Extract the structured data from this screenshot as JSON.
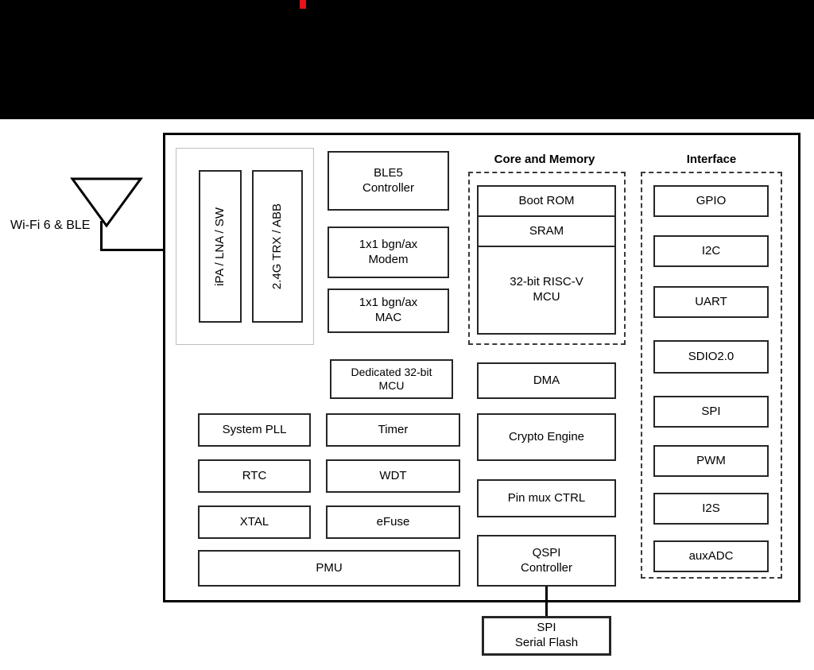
{
  "meta": {
    "title": "Wi-Fi 6 & BLE SoC Block Diagram",
    "accent_red": "#e8121a",
    "band_color": "#000000"
  },
  "antenna": {
    "label": "Wi-Fi 6 & BLE",
    "icon": "antenna-icon"
  },
  "rf_group": {
    "blocks": [
      {
        "label": "iPA / LNA / SW"
      },
      {
        "label": "2.4G TRX / ABB"
      }
    ]
  },
  "radio_column": {
    "blocks": [
      {
        "label": "BLE5\nController"
      },
      {
        "label": "1x1 bgn/ax\nModem"
      },
      {
        "label": "1x1 bgn/ax\nMAC"
      },
      {
        "label": "Dedicated 32-bit\nMCU"
      }
    ]
  },
  "left_column": {
    "blocks": [
      {
        "label": "System PLL"
      },
      {
        "label": "RTC"
      },
      {
        "label": "XTAL"
      }
    ]
  },
  "mid_column": {
    "blocks": [
      {
        "label": "Timer"
      },
      {
        "label": "WDT"
      },
      {
        "label": "eFuse"
      }
    ]
  },
  "pmu": {
    "label": "PMU"
  },
  "core_and_memory": {
    "title": "Core and Memory",
    "stack": [
      {
        "label": "Boot ROM"
      },
      {
        "label": "SRAM"
      },
      {
        "label": "32-bit RISC-V\nMCU"
      }
    ],
    "blocks": [
      {
        "label": "DMA"
      },
      {
        "label": "Crypto Engine"
      },
      {
        "label": "Pin mux CTRL"
      },
      {
        "label": "QSPI\nController"
      }
    ]
  },
  "interface": {
    "title": "Interface",
    "blocks": [
      {
        "label": "GPIO"
      },
      {
        "label": "I2C"
      },
      {
        "label": "UART"
      },
      {
        "label": "SDIO2.0"
      },
      {
        "label": "SPI"
      },
      {
        "label": "PWM"
      },
      {
        "label": "I2S"
      },
      {
        "label": "auxADC"
      }
    ]
  },
  "external": {
    "flash": {
      "label": "SPI\nSerial Flash"
    }
  }
}
